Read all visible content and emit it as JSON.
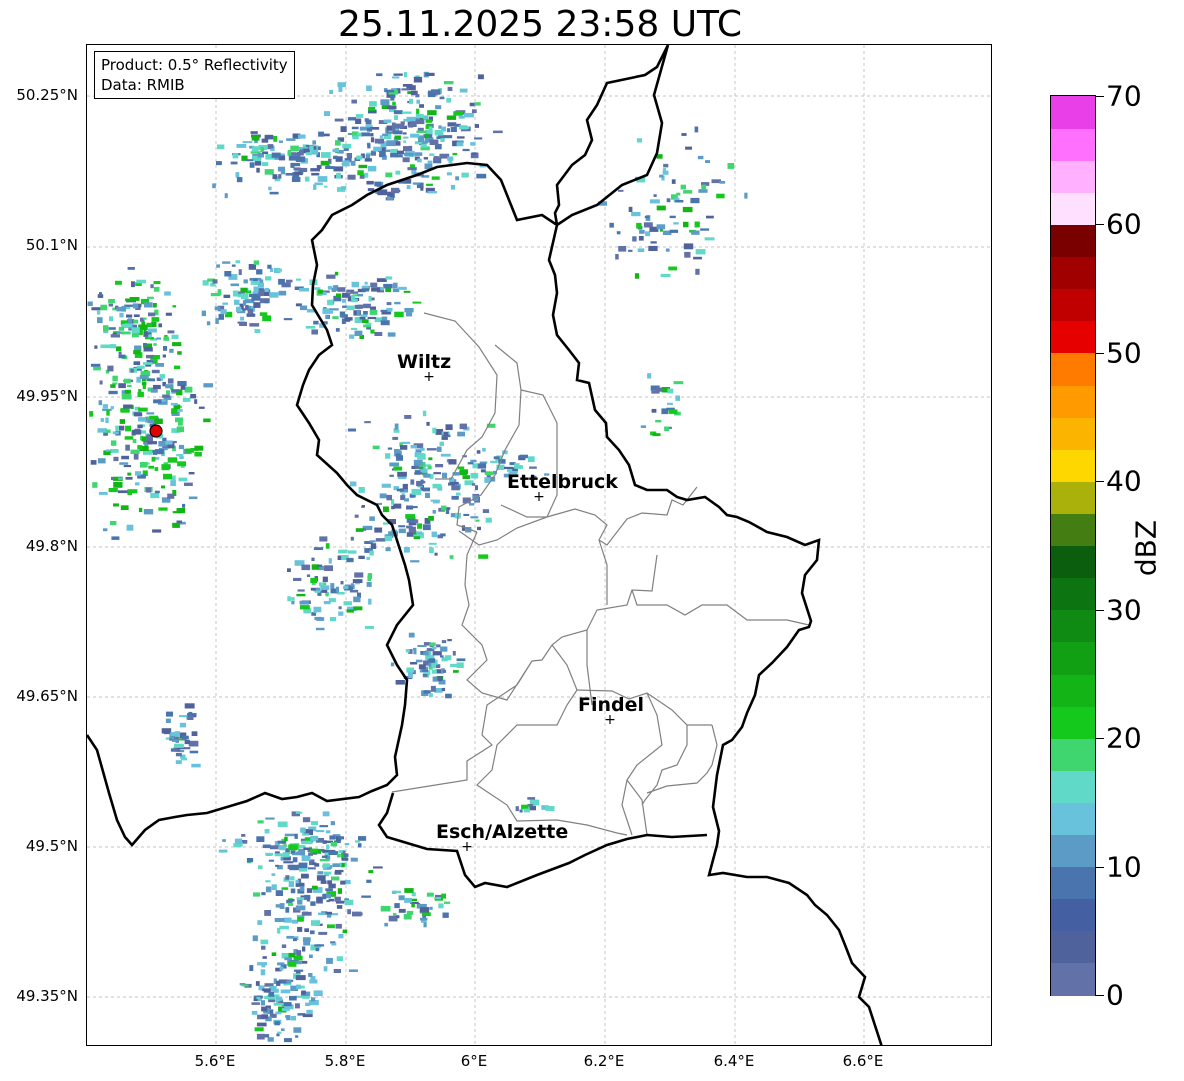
{
  "title": "25.11.2025 23:58 UTC",
  "info": {
    "product_line": "Product: 0.5° Reflectivity",
    "data_line": "Data: RMIB"
  },
  "axes": {
    "lat_labels": [
      "50.25°N",
      "50.1°N",
      "49.95°N",
      "49.8°N",
      "49.65°N",
      "49.5°N",
      "49.35°N"
    ],
    "lon_labels": [
      "5.6°E",
      "5.8°E",
      "6°E",
      "6.2°E",
      "6.4°E",
      "6.6°E"
    ]
  },
  "colorbar": {
    "unit": "dBZ",
    "min": 0,
    "max": 70,
    "tick_labels": [
      "0",
      "10",
      "20",
      "30",
      "40",
      "50",
      "60",
      "70"
    ],
    "colors": [
      "#6272a8",
      "#50629b",
      "#4460a3",
      "#4a74ad",
      "#5b9bc6",
      "#69c2dc",
      "#61d9c9",
      "#3fd670",
      "#14c81c",
      "#12b416",
      "#11a014",
      "#0f8a12",
      "#0c7410",
      "#0a5e0d",
      "#447d12",
      "#aab10a",
      "#ffd700",
      "#fbb400",
      "#ff9a00",
      "#ff7b00",
      "#e60000",
      "#c00000",
      "#a00000",
      "#7a0000",
      "#ffe0ff",
      "#ffb0ff",
      "#ff70ff",
      "#e83fe8"
    ]
  },
  "cities": [
    {
      "name": "Wiltz"
    },
    {
      "name": "Ettelbruck"
    },
    {
      "name": "Findel"
    },
    {
      "name": "Esch/Alzette"
    }
  ]
}
